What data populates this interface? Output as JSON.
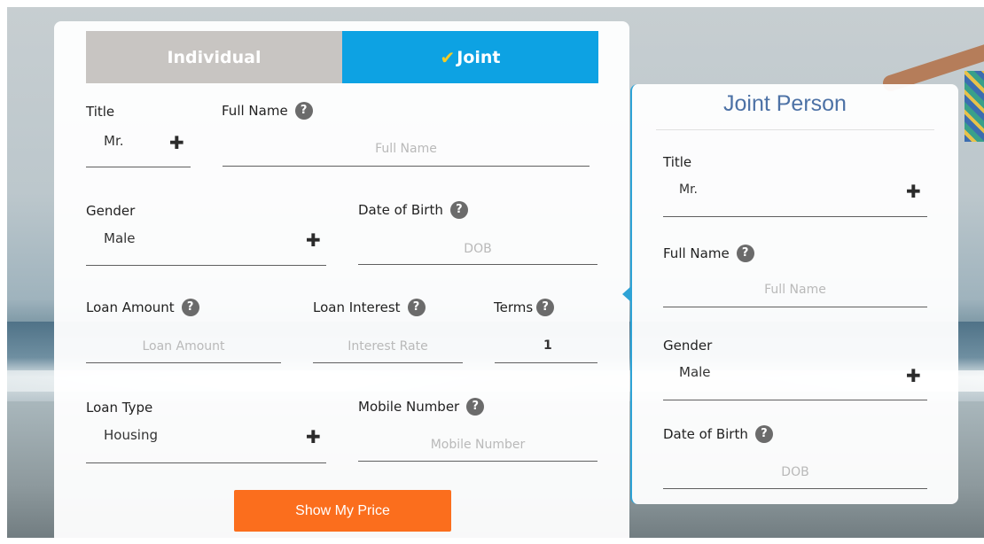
{
  "tabs": {
    "individual": "Individual",
    "joint": "Joint",
    "joint_check": "✔"
  },
  "form": {
    "title": {
      "label": "Title",
      "value": "Mr."
    },
    "full_name": {
      "label": "Full Name",
      "placeholder": "Full Name"
    },
    "gender": {
      "label": "Gender",
      "value": "Male"
    },
    "dob": {
      "label": "Date of Birth",
      "placeholder": "DOB"
    },
    "loan_amount": {
      "label": "Loan Amount",
      "placeholder": "Loan Amount"
    },
    "loan_interest": {
      "label": "Loan Interest",
      "placeholder": "Interest Rate"
    },
    "terms": {
      "label": "Terms",
      "value": "1"
    },
    "loan_type": {
      "label": "Loan Type",
      "value": "Housing"
    },
    "mobile": {
      "label": "Mobile Number",
      "placeholder": "Mobile Number"
    },
    "submit_label": "Show My Price"
  },
  "joint_person": {
    "heading": "Joint Person",
    "title": {
      "label": "Title",
      "value": "Mr."
    },
    "full_name": {
      "label": "Full Name",
      "placeholder": "Full Name"
    },
    "gender": {
      "label": "Gender",
      "value": "Male"
    },
    "dob": {
      "label": "Date of Birth",
      "placeholder": "DOB"
    }
  },
  "icons": {
    "help": "?",
    "plus": "✚"
  },
  "colors": {
    "joint_tab": "#0da2e3",
    "individual_tab": "#c8c5c2",
    "button": "#fb6e1d",
    "check": "#f3cc25",
    "joint_heading": "#4d72a6"
  }
}
